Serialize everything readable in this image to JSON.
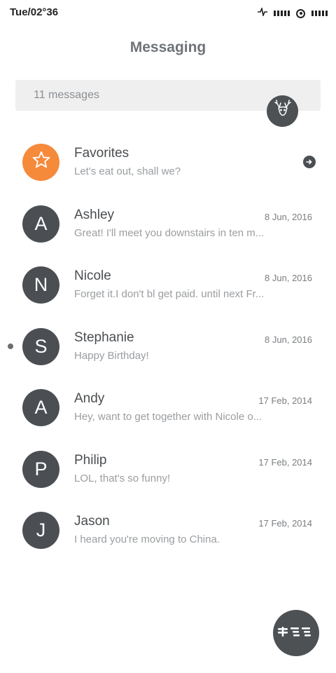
{
  "status_bar": {
    "time": "Tue/02°36",
    "icons": [
      "activity-icon",
      "signal-icon",
      "target-icon",
      "battery-icon"
    ]
  },
  "title": "Messaging",
  "search": {
    "text": "11 messages"
  },
  "deer_button": {
    "icon": "deer-icon"
  },
  "conversations": [
    {
      "avatar": "star-icon",
      "name": "Favorites",
      "preview": "Let's eat out, shall we?",
      "date": "",
      "action_icon": "arrow-right-icon",
      "color": "#f58a3b"
    },
    {
      "avatar": "A",
      "name": "Ashley",
      "preview": "Great! I'll meet you downstairs in ten m...",
      "date": "8 Jun, 2016"
    },
    {
      "avatar": "N",
      "name": "Nicole",
      "preview": "Forget it.I don't bl get paid. until next Fr...",
      "date": "8 Jun, 2016"
    },
    {
      "avatar": "S",
      "name": "Stephanie",
      "preview": "Happy Birthday!",
      "date": "8 Jun, 2016",
      "unread": true
    },
    {
      "avatar": "A",
      "name": "Andy",
      "preview": "Hey, want to get together with Nicole o...",
      "date": "17 Feb, 2014"
    },
    {
      "avatar": "P",
      "name": "Philip",
      "preview": "LOL, that's so funny!",
      "date": "17 Feb, 2014"
    },
    {
      "avatar": "J",
      "name": "Jason",
      "preview": "I heard you're moving to China.",
      "date": "17 Feb, 2014"
    }
  ],
  "fab": {
    "icon": "compose-icon"
  },
  "colors": {
    "avatar": "#4b4f53",
    "favorite": "#f58a3b",
    "search_bg": "#efefef",
    "title": "#6f7377"
  }
}
